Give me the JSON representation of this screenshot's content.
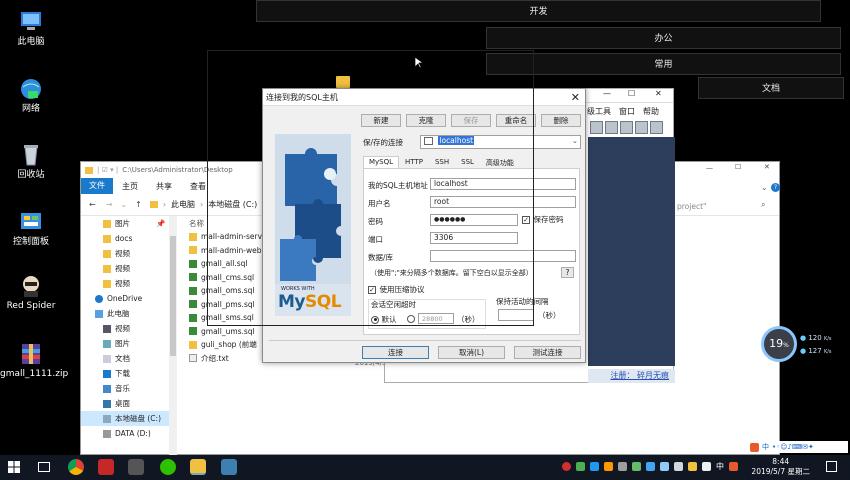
{
  "desktop": {
    "icons": [
      {
        "label": "此电脑"
      },
      {
        "label": "网络"
      },
      {
        "label": "回收站"
      },
      {
        "label": "控制面板"
      },
      {
        "label": "Red Spider"
      },
      {
        "label": "gmall_1111.zip"
      }
    ],
    "bars": [
      "开发",
      "办公",
      "常用",
      "文档"
    ]
  },
  "explorer": {
    "path": "C:\\Users\\Administrator\\Desktop",
    "ribbon_tabs": [
      "文件",
      "主页",
      "共享",
      "查看"
    ],
    "breadcrumb": [
      "此电脑",
      "本地磁盘 (C:)"
    ],
    "search_placeholder": "project\"",
    "nav": [
      {
        "label": "图片",
        "pin": true
      },
      {
        "label": "docs"
      },
      {
        "label": "视频"
      },
      {
        "label": "视频"
      },
      {
        "label": "视频"
      },
      {
        "label": "OneDrive"
      },
      {
        "label": "此电脑"
      },
      {
        "label": "视频"
      },
      {
        "label": "图片"
      },
      {
        "label": "文档"
      },
      {
        "label": "下载"
      },
      {
        "label": "音乐"
      },
      {
        "label": "桌面"
      },
      {
        "label": "本地磁盘 (C:)"
      },
      {
        "label": "DATA (D:)"
      }
    ],
    "column_header": "名称",
    "files": [
      "mall-admin-serv",
      "mall-admin-web",
      "gmall_all.sql",
      "gmall_cms.sql",
      "gmall_oms.sql",
      "gmall_pms.sql",
      "gmall_sms.sql",
      "gmall_ums.sql",
      "guli_shop (前端",
      "介绍.txt"
    ],
    "date_snippet": "2019/4/3"
  },
  "sqlyog": {
    "menu": [
      "级工具",
      "窗口",
      "帮助"
    ],
    "status_text": "注册：  碎月无痕"
  },
  "dialog": {
    "title": "连接到我的SQL主机",
    "buttons": [
      "新建",
      "克隆",
      "保存",
      "重命名",
      "删除"
    ],
    "saved_conn_label": "保/存的连接",
    "saved_conn_value": "localhost",
    "tabs": [
      "MySQL",
      "HTTP",
      "SSH",
      "SSL",
      "高级功能"
    ],
    "host_label": "我的SQL主机地址",
    "host_value": "localhost",
    "user_label": "用户名",
    "user_value": "root",
    "password_label": "密码",
    "password_value": "●●●●●●",
    "save_password_label": "保存密码",
    "port_label": "端口",
    "port_value": "3306",
    "database_label": "数据/库",
    "database_hint": "（使用\";\"来分隔多个数据库。留下空白以显示全部）",
    "hint_button": "?",
    "compress_label": "使用压缩协议",
    "session_timeout_label": "会话空闲超时",
    "default_label": "默认",
    "timeout_value": "28800",
    "seconds_label": "（秒）",
    "keepalive_label": "保持活动的间隔",
    "connect_btn": "连接",
    "cancel_btn": "取消(L)",
    "test_btn": "测试连接",
    "logo_works": "WORKS WITH",
    "logo_my": "My",
    "logo_sql": "SQL"
  },
  "gauge": {
    "percent": "19",
    "percent_sign": "%",
    "upload": "120",
    "download": "127",
    "unit": "K/s"
  },
  "taskbar": {
    "time": "8:44",
    "date": "2019/5/7 星期二",
    "ime": "中"
  }
}
